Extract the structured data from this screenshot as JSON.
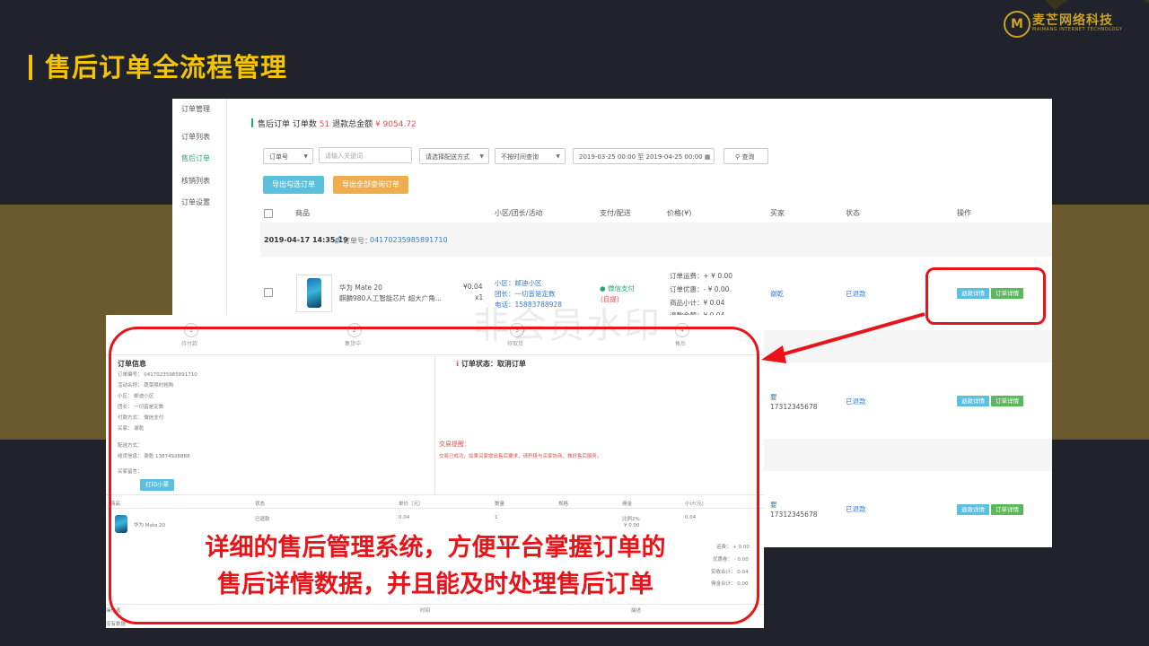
{
  "slide": {
    "title": "售后订单全流程管理",
    "logo_name": "麦芒网络科技",
    "logo_sub": "MAIMANG INTERNET TECHNOLOGY",
    "caption_line1": "详细的售后管理系统，方便平台掌握订单的",
    "caption_line2": "售后详情数据，并且能及时处理售后订单",
    "watermark": "非会员水印"
  },
  "sidebar": {
    "items": [
      {
        "label": "订单管理"
      },
      {
        "label": "订单列表"
      },
      {
        "label": "售后订单"
      },
      {
        "label": "核销列表"
      },
      {
        "label": "订单设置"
      }
    ]
  },
  "header": {
    "prefix": "售后订单 订单数",
    "count": "51",
    "mid": "退款总金额",
    "amount": "¥ 9054.72"
  },
  "filters": {
    "order_select": "订单号",
    "keyword_placeholder": "请输入关键词",
    "delivery_select": "请选择配送方式",
    "time_select": "不按时间查询",
    "date_range": "2019-03-25 00:00 至 2019-04-25 00:00",
    "query_label": "查询",
    "export_selected": "导出勾选订单",
    "export_all": "导出全部查询订单"
  },
  "table": {
    "columns": [
      "商品",
      "小区/团长/活动",
      "支付/配送",
      "价格(¥)",
      "买家",
      "状态",
      "操作"
    ],
    "order_time": "2019-04-17 14:35:19",
    "order_no_label": "订单号：",
    "order_no": "04170235985891710",
    "product_name": "华为 Mate 20",
    "product_desc": "麒麟980人工智能芯片 超大广角...",
    "price": "¥0.04",
    "qty": "x1",
    "community": "小区：邮迪小区",
    "leader": "团长：一切皆是定数",
    "phone": "电话：15883788928",
    "pay_method": "微信支付",
    "delivery": "(自提)",
    "fee_shipping": "订单运费：+ ¥ 0.00",
    "fee_discount": "订单优惠：- ¥ 0.00",
    "fee_subtotal": "商品小计：¥ 0.04",
    "fee_refund": "退款金额：¥ 0.04",
    "buyer1": "谢乾",
    "status1": "已退款",
    "buyer2": "要",
    "buyer2_phone": "17312345678",
    "status2": "已退款",
    "buyer3": "要",
    "buyer3_phone": "17312345678",
    "status3": "已退款",
    "refund_detail": "退款详情",
    "order_detail": "订单详情"
  },
  "detail": {
    "steps": [
      {
        "num": "1",
        "label": "待付款"
      },
      {
        "num": "2",
        "label": "集货中"
      },
      {
        "num": "3",
        "label": "待取货"
      },
      {
        "num": "4",
        "label": "售后"
      }
    ],
    "info_title": "订单信息",
    "order_no": "订单编号：  04170235985891710",
    "activity": "活动名称：  蔬菜限时抢购",
    "community": "小区：        邮迪小区",
    "leader": "团长：        一切皆是定数",
    "pay": "付款方式：  微信支付",
    "buyer": "买家：        谢乾",
    "delivery": "配送方式：",
    "receiver": "收货信息：  谢乾  13874928888",
    "remark": "买家留言：",
    "print_label": "打印小票",
    "status_title": "订单状态：取消订单",
    "tip_title": "交易提醒：",
    "tip_text": "交易已成功，如果买家提出售后要求，请积极与买家协商，做好售后服务。",
    "cols": [
      "商品",
      "状态",
      "单价（元）",
      "数量",
      "规格",
      "佣金",
      "小计(元)"
    ],
    "item_name": "华为 Mate 20",
    "item_status": "已退款",
    "item_price": "0.04",
    "item_qty": "1",
    "item_commission": "比例2%",
    "item_commission2": "¥ 0.00",
    "item_subtotal": "0.04",
    "sum_shipping": "运费：  + 0.00",
    "sum_discount": "优惠卷：  - 0.00",
    "sum_paid": "实收合计：  0.04",
    "sum_commission": "佣金合计：  0.00",
    "log_cols": [
      "操作者",
      "时间",
      "描述"
    ],
    "log_empty": "没有数据"
  },
  "colors": {
    "accent_yellow": "#f5c400",
    "highlight_red": "#e8141a",
    "table_green": "#2aa866"
  }
}
